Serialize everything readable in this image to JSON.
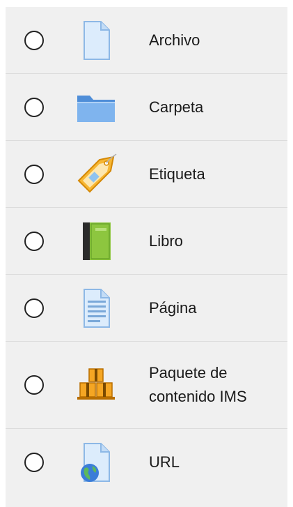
{
  "activities": [
    {
      "label": "Archivo",
      "icon": "file-icon"
    },
    {
      "label": "Carpeta",
      "icon": "folder-icon"
    },
    {
      "label": "Etiqueta",
      "icon": "tag-icon"
    },
    {
      "label": "Libro",
      "icon": "book-icon"
    },
    {
      "label": "Página",
      "icon": "page-icon"
    },
    {
      "label_line1": "Paquete de",
      "label_line2": "contenido IMS",
      "icon": "package-icon"
    },
    {
      "label": "URL",
      "icon": "url-globe-icon"
    }
  ],
  "colors": {
    "panel_bg": "#f0f0f0",
    "row_divider": "#dcdcdc",
    "file_blue": "#d6e9fb",
    "folder_blue": "#6fa8e6",
    "tag_orange": "#f5a623",
    "book_green": "#8bc34a",
    "package_orange": "#f0a020"
  }
}
